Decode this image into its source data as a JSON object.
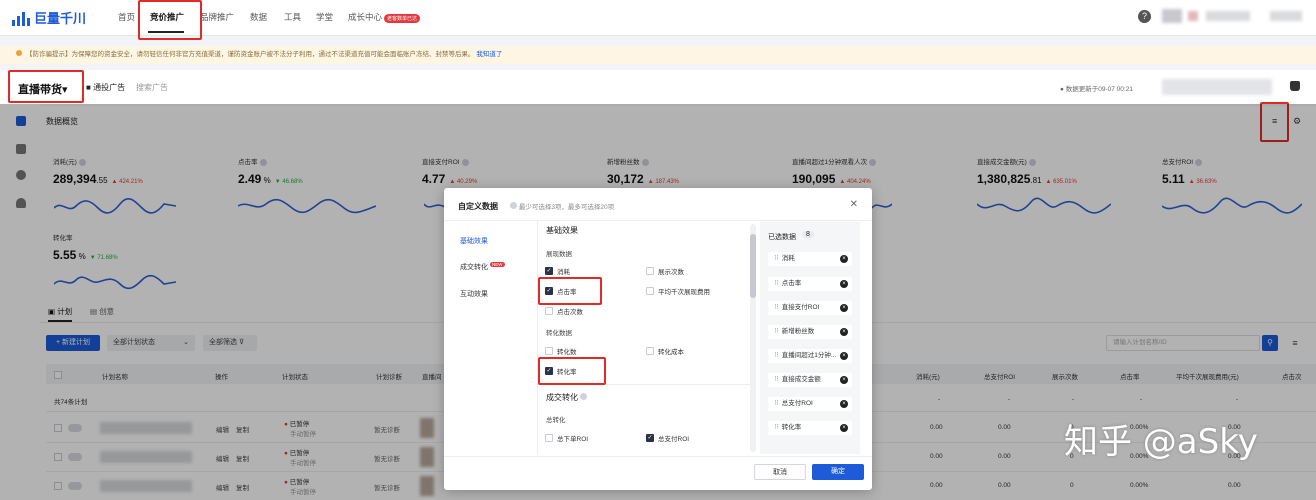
{
  "topbar": {
    "logo_text": "巨量千川",
    "nav": [
      "首页",
      "竞价推广",
      "品牌推广",
      "数据",
      "工具",
      "学堂",
      "成长中心"
    ],
    "growth_badge": "老客数单已达",
    "help_icon": "question-icon"
  },
  "banner": {
    "text": "【防诈骗提示】为保障您的资金安全，请勿轻信任何非官方充值渠道，谨防资金账户被不法分子利用，通过不法渠道充值可能会面临账户冻结、封禁等后果。",
    "link": "我知道了"
  },
  "subbar": {
    "title": "直播带货",
    "general_ad": "通投广告",
    "search_ad": "搜索广告",
    "updated": "数据更新于09-07 00:21"
  },
  "overview": {
    "title": "数据概览",
    "metrics": [
      {
        "label": "消耗(元)",
        "value": "289,394",
        "dec": ".55",
        "change": "424.21%",
        "dir": "up"
      },
      {
        "label": "点击率",
        "value": "2.49",
        "dec": " %",
        "change": "46.68%",
        "dir": "down"
      },
      {
        "label": "直接支付ROI",
        "value": "4.77",
        "dec": "",
        "change": "40.29%",
        "dir": "up"
      },
      {
        "label": "新增粉丝数",
        "value": "30,172",
        "dec": "",
        "change": "187.43%",
        "dir": "up"
      },
      {
        "label": "直播间超过1分钟观看人次",
        "value": "190,095",
        "dec": "",
        "change": "404.24%",
        "dir": "up"
      },
      {
        "label": "直接成交金额(元)",
        "value": "1,380,825",
        "dec": ".81",
        "change": "635.01%",
        "dir": "up"
      },
      {
        "label": "总支付ROI",
        "value": "5.11",
        "dec": "",
        "change": "36.63%",
        "dir": "up"
      },
      {
        "label": "转化率",
        "value": "5.55",
        "dec": " %",
        "change": "71.68%",
        "dir": "down"
      }
    ]
  },
  "table": {
    "tabs": [
      "计划",
      "创意"
    ],
    "new_plan": "+ 新建计划",
    "status_filter": "全部计划状态",
    "all_filter": "全部筛选",
    "search_placeholder": "请输入计划名称/ID",
    "headers": [
      "计划名称",
      "操作",
      "计划状态",
      "计划诊断",
      "直播间",
      "消耗(元)",
      "总支付ROI",
      "展示次数",
      "点击率",
      "平均千次展现费用(元)",
      "点击次"
    ],
    "total": "共74条计划",
    "rows": [
      {
        "op1": "编辑",
        "op2": "复制",
        "status": "已暂停",
        "sub": "手动暂停",
        "diag": "暂无诊断",
        "cost": "0.00",
        "roi": "0.00",
        "shows": "0",
        "ctr": "0.00%",
        "cpm": "0.00"
      },
      {
        "op1": "编辑",
        "op2": "复制",
        "status": "已暂停",
        "sub": "手动暂停",
        "diag": "暂无诊断",
        "cost": "0.00",
        "roi": "0.00",
        "shows": "0",
        "ctr": "0.00%",
        "cpm": "0.00"
      },
      {
        "op1": "编辑",
        "op2": "复制",
        "status": "已暂停",
        "sub": "手动暂停",
        "diag": "暂无诊断",
        "cost": "0.00",
        "roi": "0.00",
        "shows": "0",
        "ctr": "0.00%",
        "cpm": "0.00"
      }
    ],
    "totals": {
      "cost": "-",
      "roi": "-",
      "shows": "-",
      "ctr": "-",
      "cpm": "-"
    }
  },
  "dialog": {
    "title": "自定义数据",
    "hint": "最少可选择3项，最多可选择20项",
    "tabs": [
      "基础效果",
      "成交转化",
      "互动效果"
    ],
    "new_badge": "NEW",
    "section1": "基础效果",
    "group_display": "展现数据",
    "opts_display": [
      {
        "label": "消耗",
        "checked": true
      },
      {
        "label": "展示次数",
        "checked": false
      },
      {
        "label": "点击率",
        "checked": true
      },
      {
        "label": "平均千次展现费用",
        "checked": false
      },
      {
        "label": "点击次数",
        "checked": false
      }
    ],
    "group_convert": "转化数据",
    "opts_convert": [
      {
        "label": "转化数",
        "checked": false
      },
      {
        "label": "转化成本",
        "checked": false
      },
      {
        "label": "转化率",
        "checked": true
      }
    ],
    "section2": "成交转化",
    "group_total": "总转化",
    "opts_total": [
      {
        "label": "总下单ROI",
        "checked": false
      },
      {
        "label": "总支付ROI",
        "checked": true
      }
    ],
    "selected_title": "已选数据",
    "selected_count": "8",
    "selected": [
      "消耗",
      "点击率",
      "直接支付ROI",
      "新增粉丝数",
      "直播间超过1分钟...",
      "直接成交金额",
      "总支付ROI",
      "转化率"
    ],
    "cancel": "取消",
    "confirm": "确定"
  },
  "watermark": "知乎 @aSky",
  "colors": {
    "accent": "#1e5bd8",
    "highlight": "#e02b27",
    "up": "#e4393c",
    "down": "#2aa84a"
  }
}
